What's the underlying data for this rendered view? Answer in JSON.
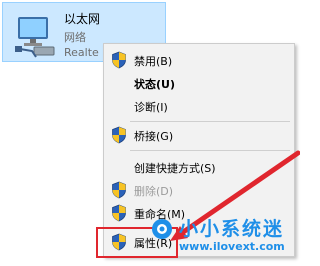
{
  "adapter": {
    "name": "以太网",
    "status": "网络",
    "device": "Realte"
  },
  "context_menu": {
    "items": [
      {
        "label": "禁用(B)",
        "shield": true,
        "bold": false,
        "disabled": false
      },
      {
        "label": "状态(U)",
        "shield": false,
        "bold": true,
        "disabled": false
      },
      {
        "label": "诊断(I)",
        "shield": false,
        "bold": false,
        "disabled": false
      },
      {
        "label": "桥接(G)",
        "shield": true,
        "bold": false,
        "disabled": false
      },
      {
        "label": "创建快捷方式(S)",
        "shield": false,
        "bold": false,
        "disabled": false
      },
      {
        "label": "删除(D)",
        "shield": true,
        "bold": false,
        "disabled": true
      },
      {
        "label": "重命名(M)",
        "shield": true,
        "bold": false,
        "disabled": false
      },
      {
        "label": "属性(R)",
        "shield": true,
        "bold": false,
        "disabled": false
      }
    ]
  },
  "annotation": {
    "arrow_color": "#e0262e",
    "highlight_color": "#e0262e"
  },
  "watermark": {
    "title": "小小系统迷",
    "url": "www.ilovext.com",
    "color": "#1f8fe8"
  }
}
